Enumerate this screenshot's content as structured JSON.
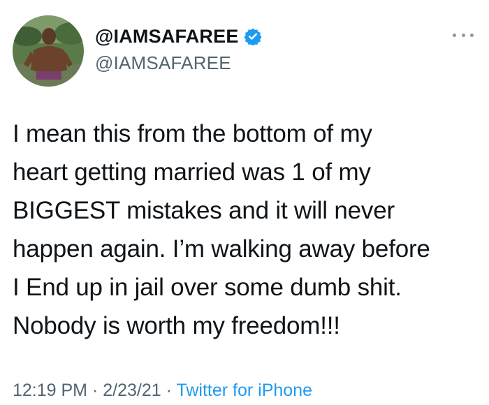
{
  "header": {
    "display_name": "@IAMSAFAREE",
    "handle": "@IAMSAFAREE",
    "verified_icon": "verified-badge-icon",
    "more_icon": "more-options-icon",
    "avatar_icon": "profile-avatar"
  },
  "tweet": {
    "lines": [
      "I mean this from the bottom of my",
      "heart getting married was 1 of my",
      "BIGGEST mistakes and it will never",
      "happen again. I’m walking away before",
      "I End up in jail over some dumb shit.",
      "Nobody is worth my freedom!!!"
    ]
  },
  "meta": {
    "time": "12:19 PM",
    "separator": "·",
    "date": "2/23/21",
    "source": "Twitter for iPhone"
  },
  "colors": {
    "accent": "#1d9bf0",
    "secondary_text": "#536471",
    "primary_text": "#0f1419"
  }
}
